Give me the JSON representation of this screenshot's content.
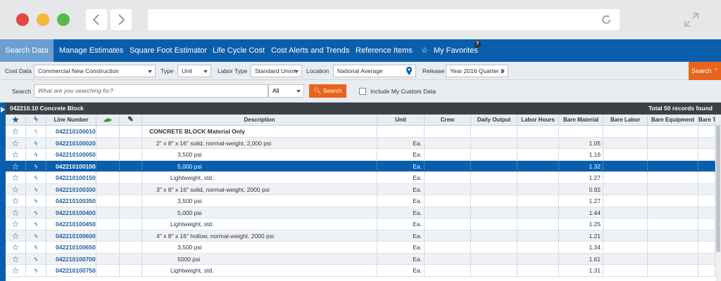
{
  "nav": {
    "tabs": [
      {
        "label": "Search Data",
        "active": true
      },
      {
        "label": "Manage Estimates"
      },
      {
        "label": "Square Foot Estimator"
      },
      {
        "label": "Life Cycle Cost"
      },
      {
        "label": "Cost Alerts and Trends"
      },
      {
        "label": "Reference Items"
      },
      {
        "label": "My Favorites"
      }
    ],
    "favorites_badge": "?"
  },
  "filters": {
    "cost_data_label": "Cost Data",
    "cost_data_value": "Commercial New Construction",
    "type_label": "Type",
    "type_value": "Unit",
    "labor_type_label": "Labor Type",
    "labor_type_value": "Standard Union",
    "location_label": "Location",
    "location_value": "National Average",
    "release_label": "Release",
    "release_value": "Year 2016 Quarter 2",
    "search_toggle": "Search"
  },
  "search": {
    "label": "Search",
    "placeholder": "What are you searching for?",
    "scope_value": "All",
    "button": "Search",
    "include_custom": "Include My Custom Data"
  },
  "grid": {
    "group_title": "042210.10 Concrete Block",
    "total": "Total 50 records found",
    "columns": [
      "Line Number",
      "Description",
      "Unit",
      "Crew",
      "Daily Output",
      "Labor Hours",
      "Bare Material",
      "Bare Labor",
      "Bare Equipment",
      "Bare T"
    ],
    "rows": [
      {
        "line": "042210100010",
        "desc": "CONCRETE BLOCK Material Only",
        "unit": "",
        "mat": "",
        "indent": 0,
        "bold": true
      },
      {
        "line": "042210100020",
        "desc": "2\" x 8\" x 16\" solid, normal-weight, 2,000 psi",
        "unit": "Ea.",
        "mat": "1.05",
        "indent": 1
      },
      {
        "line": "042210100050",
        "desc": "3,500 psi",
        "unit": "Ea.",
        "mat": "1.16",
        "indent": 2
      },
      {
        "line": "042210100100",
        "desc": "5,000 psi",
        "unit": "Ea.",
        "mat": "1.32",
        "indent": 2,
        "selected": true
      },
      {
        "line": "042210100150",
        "desc": "Lightweight, std.",
        "unit": "Ea.",
        "mat": "1.27",
        "indent": 3
      },
      {
        "line": "042210100300",
        "desc": "3\" x 8\" x 16\" solid, normal-weight, 2000 psi",
        "unit": "Ea.",
        "mat": "0.92",
        "indent": 1
      },
      {
        "line": "042210100350",
        "desc": "3,500 psi",
        "unit": "Ea.",
        "mat": "1.27",
        "indent": 2
      },
      {
        "line": "042210100400",
        "desc": "5,000 psi",
        "unit": "Ea.",
        "mat": "1.44",
        "indent": 2
      },
      {
        "line": "042210100450",
        "desc": "Lightweight, std.",
        "unit": "Ea.",
        "mat": "1.25",
        "indent": 3
      },
      {
        "line": "042210100600",
        "desc": "4\" x 8\" x 16\" hollow, normal-weight, 2000 psi",
        "unit": "Ea.",
        "mat": "1.21",
        "indent": 1
      },
      {
        "line": "042210100650",
        "desc": "3,500 psi",
        "unit": "Ea.",
        "mat": "1.34",
        "indent": 2
      },
      {
        "line": "042210100700",
        "desc": "5000 psi",
        "unit": "Ea.",
        "mat": "1.61",
        "indent": 2
      },
      {
        "line": "042210100750",
        "desc": "Lightweight, std.",
        "unit": "Ea.",
        "mat": "1.31",
        "indent": 3
      }
    ]
  },
  "colors": {
    "brand": "#0a5fad",
    "accent": "#e8641b",
    "header": "#3b4147"
  }
}
